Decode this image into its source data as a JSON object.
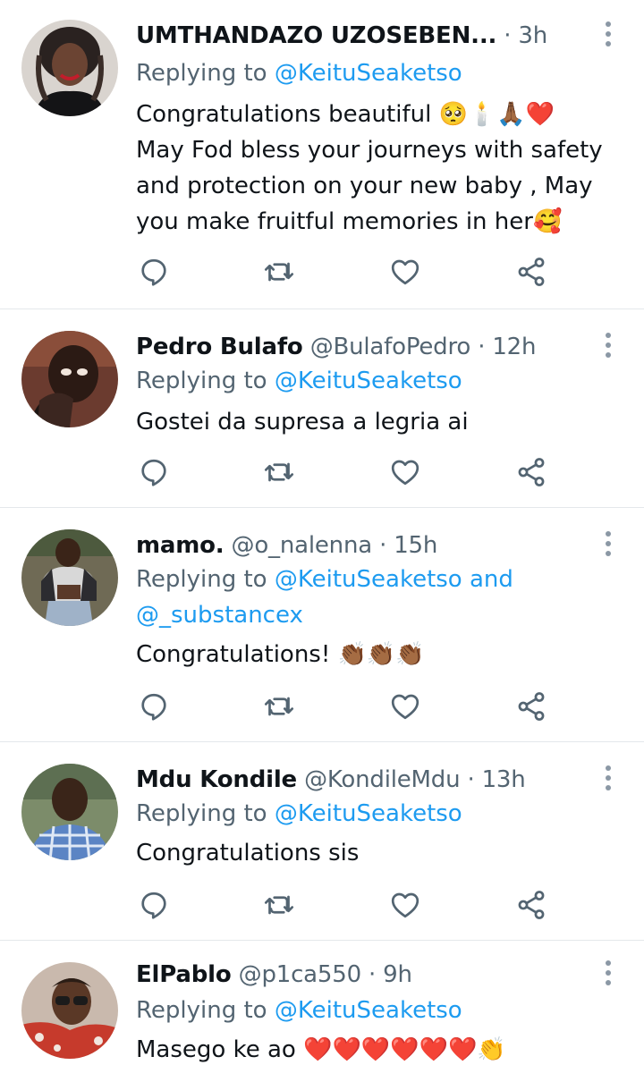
{
  "tweets": [
    {
      "name": "UMTHANDAZO UZOSEBEN...",
      "handle": "",
      "time": "3h",
      "replying_prefix": "Replying to ",
      "replying_to": "@KeituSeaketso",
      "replying_more": "",
      "body_lines": [
        "Congratulations beautiful 🥺🕯️🙏🏾❤️",
        "May Fod bless your journeys with safety",
        "and protection on your new baby , May",
        "you make fruitful memories in her🥰"
      ]
    },
    {
      "name": "Pedro Bulafo",
      "handle": "@BulafoPedro",
      "time": "12h",
      "replying_prefix": "Replying to ",
      "replying_to": "@KeituSeaketso",
      "replying_more": "",
      "body_lines": [
        "Gostei da supresa a legria ai"
      ]
    },
    {
      "name": "mamo.",
      "handle": "@o_nalenna",
      "time": "15h",
      "replying_prefix": "Replying to ",
      "replying_to": "@KeituSeaketso and",
      "replying_more": "@_substancex",
      "body_lines": [
        "Congratulations! 👏🏾👏🏾👏🏾"
      ]
    },
    {
      "name": "Mdu Kondile",
      "handle": "@KondileMdu",
      "time": "13h",
      "replying_prefix": "Replying to ",
      "replying_to": "@KeituSeaketso",
      "replying_more": "",
      "body_lines": [
        "Congratulations sis"
      ]
    },
    {
      "name": "ElPablo",
      "handle": "@p1ca550",
      "time": "9h",
      "replying_prefix": "Replying to ",
      "replying_to": "@KeituSeaketso",
      "replying_more": "",
      "body_lines": [
        "Masego ke ao ❤️❤️❤️❤️❤️❤️👏"
      ]
    }
  ],
  "icons": {
    "reply": "reply-icon",
    "retweet": "retweet-icon",
    "like": "like-icon",
    "share": "share-icon",
    "more": "more-options-icon"
  },
  "colors": {
    "link": "#1d9bf0",
    "muted": "#536471",
    "text": "#0f1419",
    "divider": "#e4e8eb"
  }
}
